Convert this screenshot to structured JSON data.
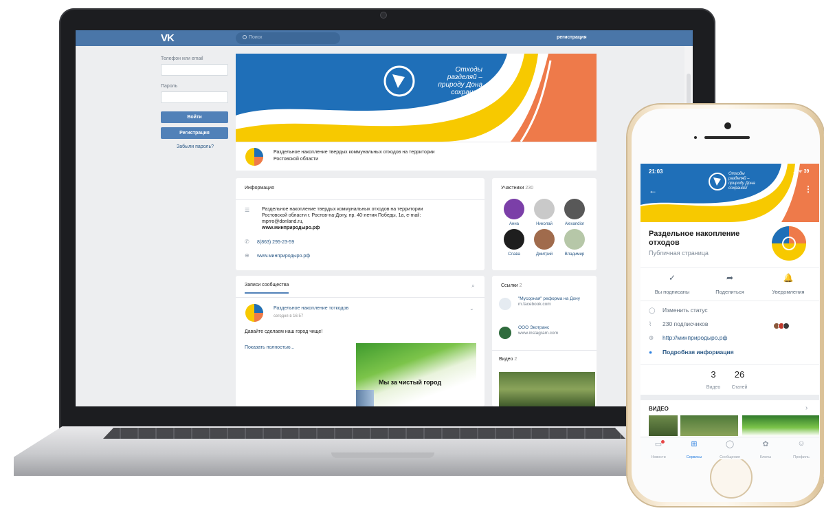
{
  "laptop": {
    "header": {
      "logo": "VK",
      "search_placeholder": "Поиск",
      "register_link": "регистрация"
    },
    "login": {
      "phone_label": "Телефон или email",
      "password_label": "Пароль",
      "login_button": "Войти",
      "register_button": "Регистрация",
      "forgot_link": "Забыли пароль?"
    },
    "cover": {
      "slogan": "Отходы разделяй – природу Дона сохраняй!"
    },
    "group": {
      "description": "Раздельное накопление твердых коммунальных отходов на территории Ростовской области"
    },
    "info": {
      "title": "Информация",
      "text": "Раздельное накопление твердых коммунальных отходов на территории Ростовской области г. Ростов-на-Дону, пр. 40-летия Победы, 1а, e-mail: mprro@donland.ru,",
      "text_bold": "www.минприродыро.рф",
      "phone": "8(863) 295-23-59",
      "site": "www.минприродыро.рф"
    },
    "members": {
      "title": "Участники",
      "count": "230",
      "items": [
        {
          "name": "Анна",
          "color": "#7b3fa8"
        },
        {
          "name": "Николай",
          "color": "#c9c9c9"
        },
        {
          "name": "Alexandior",
          "color": "#585858"
        },
        {
          "name": "Слава",
          "color": "#1e1e1e"
        },
        {
          "name": "Дмитрий",
          "color": "#a06b4c"
        },
        {
          "name": "Владимир",
          "color": "#b6c7a8"
        }
      ]
    },
    "posts": {
      "tab": "Записи сообщества",
      "author": "Раздельное накопление тоткодов",
      "date": "сегодня в 16:57",
      "text": "Давайте сделаем наш город чище!",
      "more": "Показать полностью...",
      "image_caption": "Мы за чистый город"
    },
    "links": {
      "title": "Ссылки",
      "count": "2",
      "items": [
        {
          "title": "\"Мусорная\" реформа на Дону",
          "url": "m.facebook.com"
        },
        {
          "title": "ООО Экотранс",
          "url": "www.instagram.com"
        }
      ],
      "video_title": "Видео",
      "video_count": "2"
    }
  },
  "phone": {
    "status_time": "21:03",
    "status_right": "◢ ᯤ 39",
    "cover_slogan": "Отходы разделяй – природу Дона сохраняй!",
    "name": "Раздельное накопление отходов",
    "type": "Публичная страница",
    "actions": [
      {
        "label": "Вы подписаны",
        "icon": "✓"
      },
      {
        "label": "Поделиться",
        "icon": "➦"
      },
      {
        "label": "Уведомления",
        "icon": "🔔"
      }
    ],
    "change_status": "Изменить статус",
    "subscribers": "230 подписчиков",
    "site": "http://минприродыро.рф",
    "details": "Подробная информация",
    "stats": [
      {
        "num": "3",
        "label": "Видео"
      },
      {
        "num": "26",
        "label": "Статей"
      }
    ],
    "video_section": "ВИДЕО",
    "tabs": [
      {
        "label": "Новости",
        "icon": "▭"
      },
      {
        "label": "Сервисы",
        "icon": "⊞"
      },
      {
        "label": "Сообщения",
        "icon": "◯"
      },
      {
        "label": "Клипы",
        "icon": "✿"
      },
      {
        "label": "Профиль",
        "icon": "☺"
      }
    ]
  },
  "colors": {
    "vk_blue": "#4a76a8",
    "cover_blue": "#1f6fb8",
    "cover_yellow": "#f7c900",
    "cover_orange": "#ee7a4a",
    "link": "#2a5885",
    "active_tab": "#2d81e0"
  }
}
